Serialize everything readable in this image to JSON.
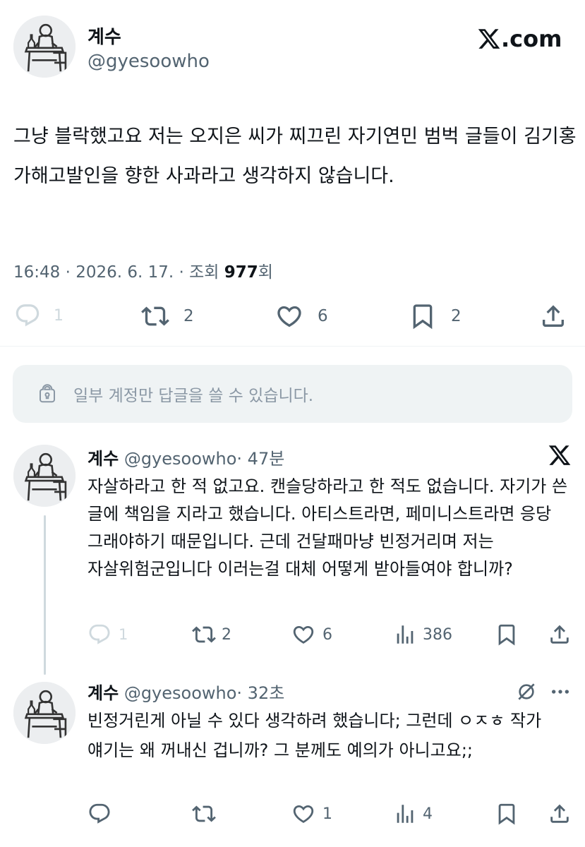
{
  "main_tweet": {
    "author_name": "계수",
    "author_handle": "@gyesoowho",
    "brand": "X.com",
    "text": "그냥 블락했고요 저는 오지은 씨가 찌끄린 자기연민 범벅 글들이 김기홍 가해고발인을 향한 사과라고 생각하지 않습니다.",
    "meta": {
      "time_date": "16:48 · 2026. 6. 17. · 조회 ",
      "views": "977",
      "views_suffix": "회"
    },
    "actions": {
      "reply_count": "1",
      "retweet_count": "2",
      "like_count": "6",
      "bookmark_count": "2"
    }
  },
  "reply_notice": {
    "text": "일부 계정만 답글을 쓸 수 있습니다."
  },
  "replies": [
    {
      "author_name": "계수",
      "author_handle": "@gyesoowho",
      "time": "· 47분",
      "text": "자살하라고 한 적 없고요. 캔슬당하라고 한 적도 없습니다. 자기가 쓴 글에 책임을 지라고 했습니다. 아티스트라면, 페미니스트라면 응당 그래야하기 때문입니다. 근데 건달패마냥 빈정거리며 저는 자살위험군입니다 이러는걸 대체 어떻게 받아들여야 합니까?",
      "actions": {
        "reply_count": "1",
        "retweet_count": "2",
        "like_count": "6",
        "view_count": "386"
      }
    },
    {
      "author_name": "계수",
      "author_handle": "@gyesoowho",
      "time": "· 32초",
      "text": "빈정거린게 아닐 수 있다 생각하려 했습니다; 그런데 ㅇㅈㅎ 작가 얘기는 왜 꺼내신 겁니까? 그 분께도 예의가 아니고요;;",
      "actions": {
        "reply_count": "",
        "retweet_count": "",
        "like_count": "1",
        "view_count": "4"
      }
    }
  ],
  "colors": {
    "text_primary": "#0f1419",
    "text_secondary": "#536471",
    "divider": "#eff3f4",
    "notice_bg": "#eff3f4",
    "thread_line": "#cfd9de"
  },
  "icons": [
    "avatar",
    "x-logo-icon",
    "reply-icon",
    "retweet-icon",
    "like-icon",
    "bookmark-icon",
    "share-icon",
    "views-icon",
    "lock-icon",
    "grok-icon",
    "more-icon"
  ]
}
